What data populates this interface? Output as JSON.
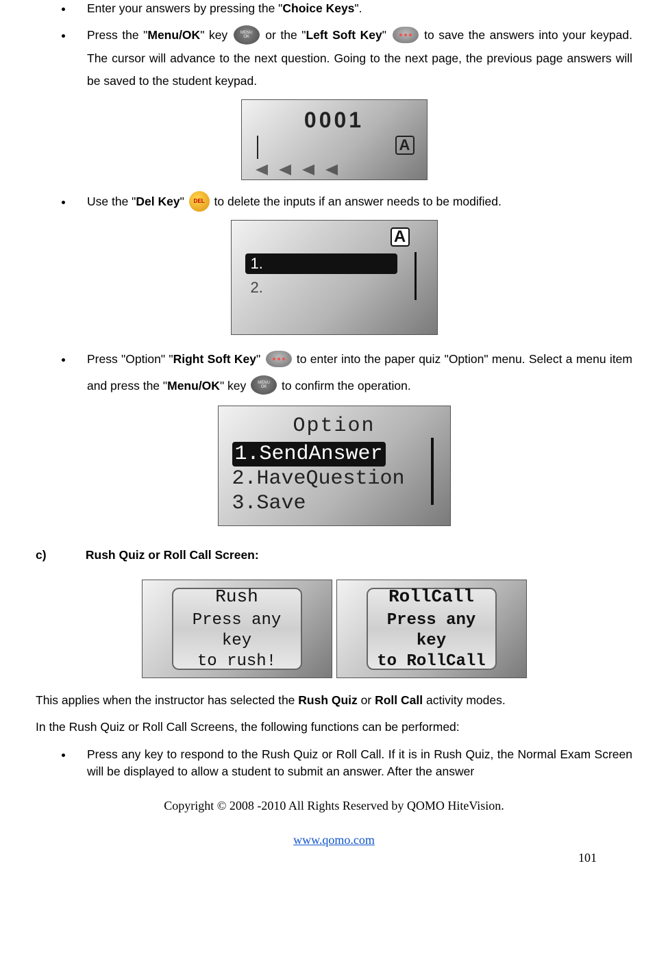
{
  "bullet1": {
    "part1": "Enter your answers by pressing the \"",
    "bold1": "Choice Keys",
    "part2": "\"."
  },
  "bullet2": {
    "p1": "Press the \"",
    "b1": "Menu/OK",
    "p2": "\" key ",
    "p3": " or the \"",
    "b2": "Left Soft Key",
    "p4": "\" ",
    "p5": " to save the answers into your keypad. The cursor will advance to the next question. Going to the next page, the previous page answers will be saved to the student keypad."
  },
  "screen1": {
    "number": "0001",
    "indicator": "A"
  },
  "bullet3": {
    "p1": "Use the \"",
    "b1": "Del Key",
    "p2": "\" ",
    "p3": " to delete the inputs if an answer needs to be modified."
  },
  "screen2": {
    "indicator": "A",
    "row1": "1.",
    "row2": "2."
  },
  "bullet4": {
    "p1": "Press \"Option\" \"",
    "b1": "Right Soft Key",
    "p2": "\" ",
    "p3": " to enter into the paper quiz \"Option\" menu. Select a menu item and press the \"",
    "b2": "Menu/OK",
    "p4": "\" key ",
    "p5": " to confirm the operation."
  },
  "screen3": {
    "title": "Option",
    "opt1": "1.SendAnswer",
    "opt2": "2.HaveQuestion",
    "opt3": "3.Save"
  },
  "sectionC": {
    "label": "c)",
    "title": "Rush Quiz or Roll Call Screen:"
  },
  "rushScreen": {
    "title": "Rush",
    "line1": "Press any key",
    "line2": "to rush!"
  },
  "rollcallScreen": {
    "title": "RollCall",
    "line1": "Press any key",
    "line2": "to RollCall"
  },
  "para1": {
    "p1": "This applies when the instructor has selected the ",
    "b1": "Rush Quiz",
    "p2": " or ",
    "b2": "Roll Call",
    "p3": " activity modes."
  },
  "para2": "In the Rush Quiz or Roll Call Screens, the following functions can be performed:",
  "bullet5": "Press any key to respond to the Rush Quiz or Roll Call. If it is in Rush Quiz, the Normal Exam Screen will be displayed to allow a student to submit an answer. After the answer",
  "footer": {
    "copyright": "Copyright © 2008 -2010 All Rights Reserved by QOMO HiteVision.",
    "url": "www.qomo.com",
    "page": "101"
  },
  "icons": {
    "menuOkLabel": "MENU\nOK",
    "delLabel": "DEL"
  }
}
